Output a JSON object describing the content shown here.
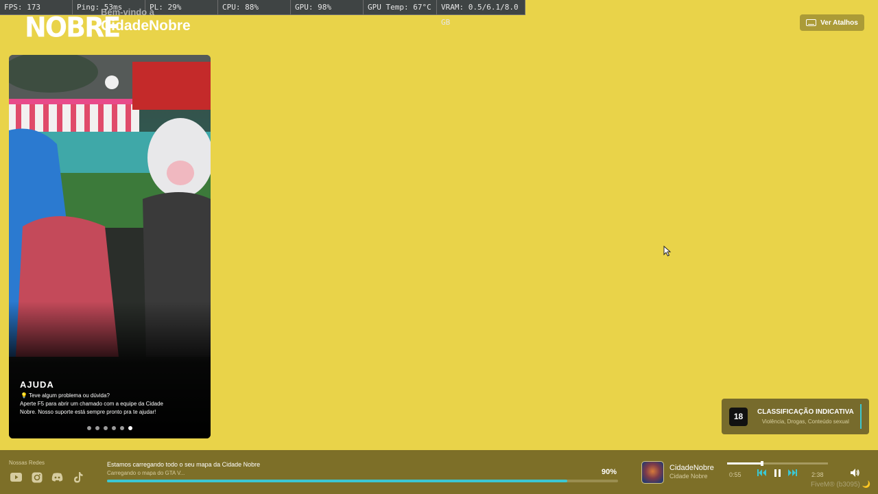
{
  "perf": {
    "fps": "FPS: 173",
    "ping": "Ping: 53ms",
    "pl": "PL: 29%",
    "cpu": "CPU: 88%",
    "gpu": "GPU: 98%",
    "gpu_temp": "GPU Temp: 67°C",
    "vram": "VRAM: 0.5/6.1/8.0 GB"
  },
  "header": {
    "logo_text": "NOBRE",
    "welcome_small": "Bem-vindo à",
    "welcome_big": "CidadeNobre",
    "shortcuts_label": "Ver Atalhos",
    "shortcuts_icon": "keyboard-icon"
  },
  "card": {
    "title": "AJUDA",
    "line1": "💡 Teve algum problema ou dúvida?",
    "body": "Aperte F5 para abrir um chamado com a equipe da Cidade Nobre. Nosso suporte está sempre pronto pra te ajudar!",
    "dots_total": 6,
    "dots_active_index": 5
  },
  "rating": {
    "age": "18",
    "title": "CLASSIFICAÇÃO INDICATIVA",
    "subtitle": "Violência, Drogas, Conteúdo sexual"
  },
  "bottom": {
    "social_label": "Nossas Redes",
    "socials": [
      "youtube-icon",
      "instagram-icon",
      "discord-icon",
      "tiktok-icon"
    ],
    "loading_title": "Estamos carregando todo o seu mapa da Cidade Nobre",
    "loading_sub": "Carregando o mapa do GTA V...",
    "percent_label": "90%",
    "progress_fraction": 0.9
  },
  "player": {
    "song_title": "CidadeNobre",
    "artist": "Cidade Nobre",
    "current_time": "0:55",
    "total_time": "2:38",
    "seek_fraction": 0.35
  },
  "fivem_label": "FiveM® (b3095)",
  "colors": {
    "background": "#e9d349",
    "accent": "#3cc7d2",
    "bar": "#7d6f28"
  }
}
